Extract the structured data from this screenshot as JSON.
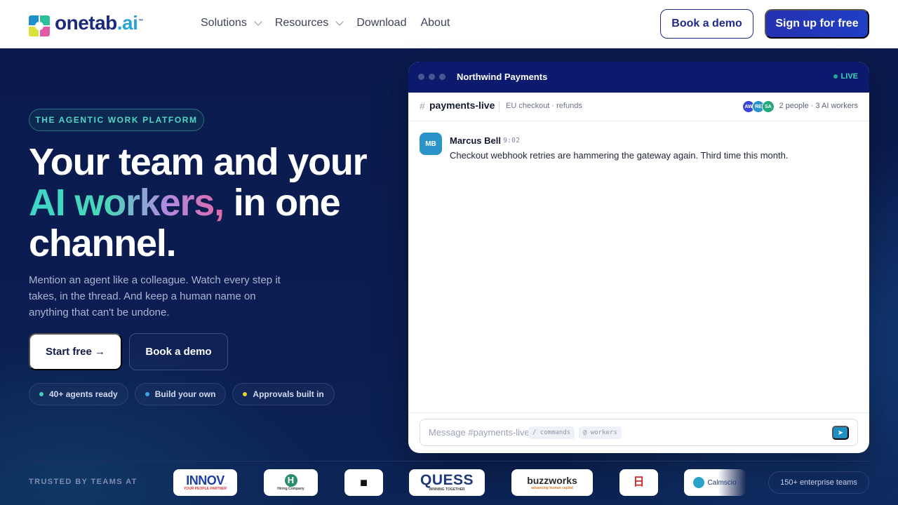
{
  "brand": {
    "name": "onetab",
    "suffix": ".ai",
    "tm": "™",
    "primary_color": "#1f2a8a",
    "accent_color": "#27a4d6"
  },
  "nav": {
    "items": [
      {
        "label": "Solutions",
        "has_dropdown": true
      },
      {
        "label": "Resources",
        "has_dropdown": true
      },
      {
        "label": "Download",
        "has_dropdown": false
      },
      {
        "label": "About",
        "has_dropdown": false
      }
    ],
    "book_demo": "Book a demo",
    "signup": "Sign up for free"
  },
  "hero": {
    "eyebrow": "THE AGENTIC WORK PLATFORM",
    "headline_1": "Your team and your",
    "headline_highlight": "AI workers,",
    "headline_2": " in one",
    "headline_3": "channel.",
    "subcopy": "Mention an agent like a colleague. Watch every step it takes, in the thread. And keep a human name on anything that can't be undone.",
    "cta_primary": "Start free →",
    "cta_secondary": "Book a demo",
    "pills": [
      {
        "label": "40+ agents ready",
        "dot_color": "#3fd3b8"
      },
      {
        "label": "Build your own",
        "dot_color": "#3aa8e8"
      },
      {
        "label": "Approvals built in",
        "dot_color": "#e6d22a"
      }
    ]
  },
  "app": {
    "workspace": "Northwind Payments",
    "status": "LIVE",
    "channel": {
      "hash": "#",
      "name": "payments-live",
      "description": "EU checkout · refunds",
      "avatars": [
        {
          "initials": "AW",
          "color": "#3b46d6"
        },
        {
          "initials": "RE",
          "color": "#2a93c8"
        },
        {
          "initials": "SA",
          "color": "#25a87a"
        }
      ],
      "members": "2 people · 3 AI workers"
    },
    "messages": [
      {
        "initials": "MB",
        "author": "Marcus Bell",
        "time": "9:02",
        "text": "Checkout webhook retries are hammering the gateway again. Third time this month."
      }
    ],
    "composer": {
      "placeholder": "Message #payments-live",
      "chip_commands": "/ commands",
      "chip_workers": "@ workers",
      "send_icon": "➤"
    }
  },
  "trusted": {
    "label": "TRUSTED BY TEAMS AT",
    "logos": [
      {
        "name": "INNOV",
        "tagline": "YOUR PEOPLE PARTNER"
      },
      {
        "name": "H",
        "tagline": "Hiring Company"
      },
      {
        "name": "■"
      },
      {
        "name": "QUESS",
        "tagline": "WINNING TOGETHER"
      },
      {
        "name": "buzzworks",
        "tagline": "advancing human capital"
      },
      {
        "name": "日"
      },
      {
        "name": "Calmscio"
      }
    ],
    "count": "150+ enterprise teams"
  }
}
